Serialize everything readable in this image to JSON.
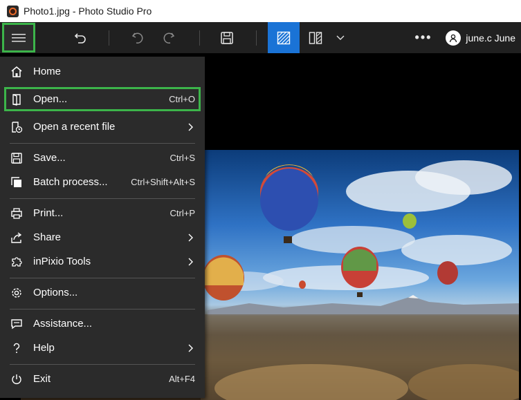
{
  "window": {
    "title": "Photo1.jpg - Photo Studio Pro"
  },
  "toolbar": {
    "user_name": "june.c June",
    "more_label": "•••"
  },
  "menu": {
    "home": {
      "label": "Home"
    },
    "open": {
      "label": "Open...",
      "shortcut": "Ctrl+O"
    },
    "recent": {
      "label": "Open a recent file"
    },
    "save": {
      "label": "Save...",
      "shortcut": "Ctrl+S"
    },
    "batch": {
      "label": "Batch process...",
      "shortcut": "Ctrl+Shift+Alt+S"
    },
    "print": {
      "label": "Print...",
      "shortcut": "Ctrl+P"
    },
    "share": {
      "label": "Share"
    },
    "inpixio": {
      "label": "inPixio Tools"
    },
    "options": {
      "label": "Options..."
    },
    "assistance": {
      "label": "Assistance..."
    },
    "help": {
      "label": "Help"
    },
    "exit": {
      "label": "Exit",
      "shortcut": "Alt+F4"
    }
  },
  "colors": {
    "accent_green": "#3cb54a",
    "active_blue": "#1a73d6",
    "menu_bg": "#2b2b2b",
    "toolbar_bg": "#202020"
  }
}
